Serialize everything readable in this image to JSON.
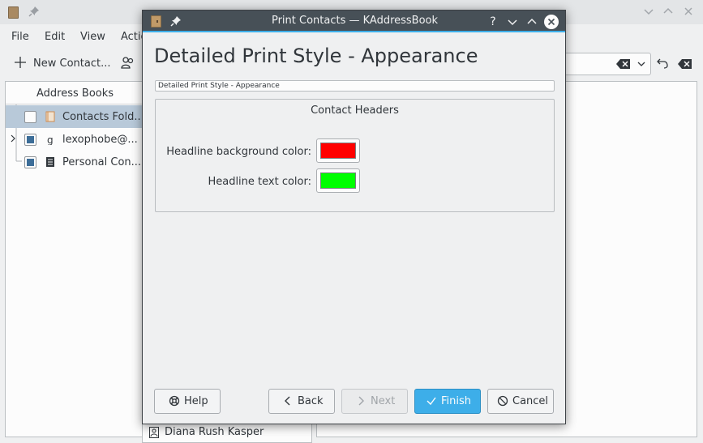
{
  "background_window": {
    "menu": [
      "File",
      "Edit",
      "View",
      "Actio"
    ],
    "toolbar": {
      "new_contact_label": "New Contact..."
    },
    "address_books": {
      "header": "Address Books",
      "items": [
        {
          "label": "Contacts Fold...",
          "icon": "folder-contacts-icon",
          "checked": false
        },
        {
          "label": "lexophobe@...",
          "icon": "google-icon",
          "checked": true
        },
        {
          "label": "Personal Con...",
          "icon": "address-book-icon",
          "checked": true
        }
      ]
    },
    "contact_list": {
      "visible_item": "Diana Rush Kasper"
    }
  },
  "dialog": {
    "title": "Print Contacts — KAddressBook",
    "help_glyph": "?",
    "heading": "Detailed Print Style - Appearance",
    "banner": "Detailed Print Style - Appearance",
    "group": {
      "title": "Contact Headers",
      "fields": [
        {
          "label": "Headline background color:",
          "color": "#ff0000"
        },
        {
          "label": "Headline text color:",
          "color": "#00ff00"
        }
      ]
    },
    "buttons": {
      "help": "Help",
      "back": "Back",
      "next": "Next",
      "finish": "Finish",
      "cancel": "Cancel"
    }
  },
  "colors": {
    "accent": "#3daee9",
    "titlebar": "#475057",
    "window": "#eff0f1"
  }
}
